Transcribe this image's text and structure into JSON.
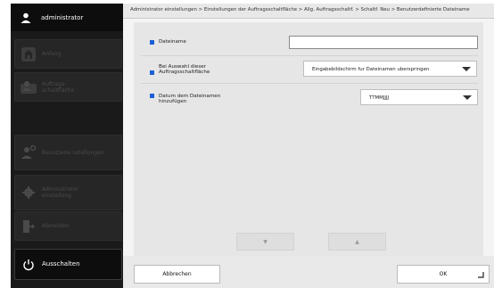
{
  "sidebar": {
    "user": {
      "label": "administrator",
      "icon": "user-icon"
    },
    "items": [
      {
        "label": "Anfang",
        "icon": "home-icon",
        "enabled": false
      },
      {
        "label": "Auftrags-\nschaltfläche",
        "icon": "job-button-icon",
        "enabled": false
      },
      {
        "label": "Benutzerei nstellungen",
        "icon": "user-settings-icon",
        "enabled": false
      },
      {
        "label": "Administrator\neinstellung",
        "icon": "admin-gear-icon",
        "enabled": false
      },
      {
        "label": "Abmelden",
        "icon": "logout-icon",
        "enabled": false
      },
      {
        "label": "Ausschalten",
        "icon": "power-icon",
        "enabled": true
      }
    ]
  },
  "breadcrumb": "Administrator einstellungen > Einstellungen der Auftragsschaltfläche > Allg. Auftragsschaltf. > Schaltf. Neu > Benutzerdefinierte Dateiname",
  "form": {
    "filename": {
      "label": "Dateiname",
      "value": ""
    },
    "on_select": {
      "label": "Bei Auswahl dieser\nAuftragsschaltfläche",
      "value": "Eingabebildschirm fur Dateinamen uberspringen"
    },
    "date": {
      "label": "Datum dem Dateinamen\nhinzufügen",
      "value": "TTMMJJJJ"
    }
  },
  "scroll": {
    "down": "▼",
    "up": "▲"
  },
  "buttons": {
    "cancel": "Abbrechen",
    "ok": "OK"
  },
  "colors": {
    "accent": "#1c5fd6",
    "sidebar_bg": "#1a1a1a"
  }
}
